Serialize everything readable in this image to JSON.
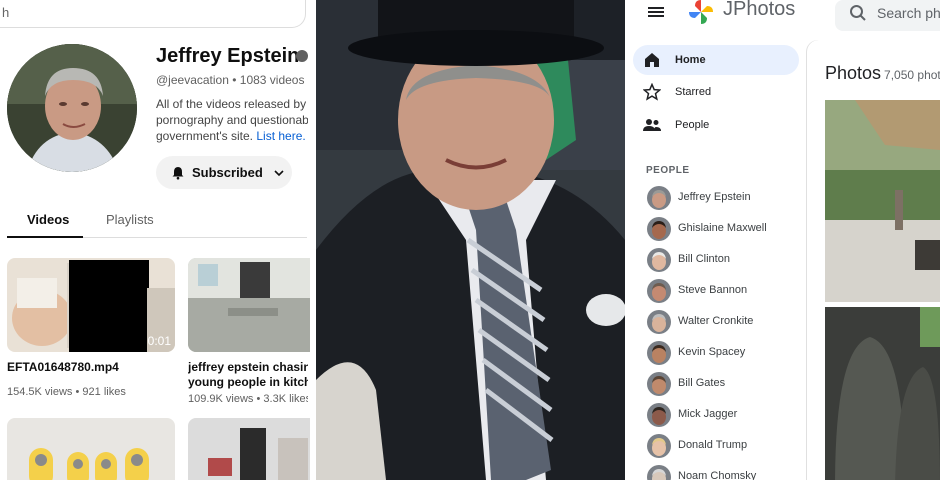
{
  "channel": {
    "search_fragment": "h",
    "name": "Jeffrey Epstein",
    "handle": "@jeevacation",
    "video_count": "1083 videos",
    "desc_line1": "All of the videos released by t",
    "desc_line2": "pornography and questionab",
    "desc_line3": "government's site.",
    "desc_link": "List here.",
    "subscribe_label": "Subscribed",
    "tabs": [
      "Videos",
      "Playlists"
    ],
    "videos": [
      {
        "title_line1": "EFTA01648780.mp4",
        "title_line2": "",
        "duration": "0:01",
        "views": "154.5K views",
        "likes": "921 likes"
      },
      {
        "title_line1": "jeffrey epstein chasing",
        "title_line2": "young people in kitche",
        "duration": "",
        "views": "109.9K views",
        "likes": "3.3K likes"
      }
    ]
  },
  "photos_app": {
    "title": "JPhotos",
    "search_placeholder": "Search photo",
    "nav": [
      {
        "label": "Home",
        "icon": "home-icon"
      },
      {
        "label": "Starred",
        "icon": "star-icon"
      },
      {
        "label": "People",
        "icon": "people-icon"
      }
    ],
    "people_section": "PEOPLE",
    "people": [
      "Jeffrey Epstein",
      "Ghislaine Maxwell",
      "Bill Clinton",
      "Steve Bannon",
      "Walter Cronkite",
      "Kevin Spacey",
      "Bill Gates",
      "Mick Jagger",
      "Donald Trump",
      "Noam Chomsky"
    ],
    "photos_heading": "Photos",
    "photos_count": "7,050 phot"
  },
  "colors": {
    "accent_blue": "#065fd4",
    "nav_active_bg": "#e8f0fe",
    "chip_bg": "#f2f2f2"
  }
}
